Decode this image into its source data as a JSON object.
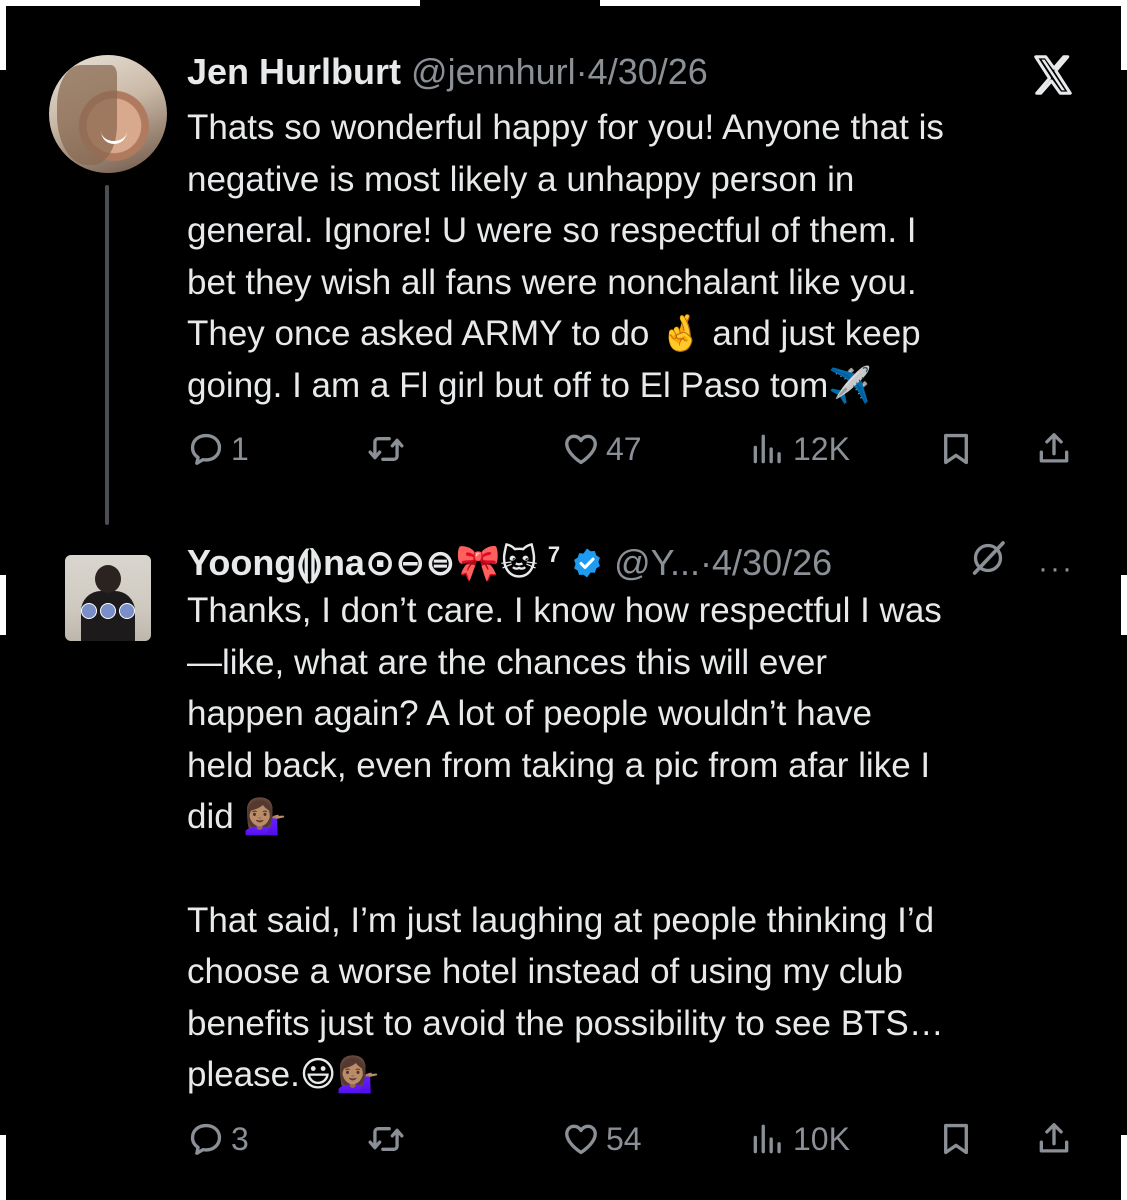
{
  "tweet1": {
    "display_name": "Jen Hurlburt",
    "handle": "@jennhurl",
    "separator": "·",
    "date": "4/30/26",
    "text": "Thats so wonderful happy for you! Anyone that is\nnegative is most likely a unhappy person in\ngeneral. Ignore! U were so respectful of them. I\nbet they wish all fans were nonchalant like you.\nThey once asked ARMY to do 🤞 and just keep\ngoing. I am a Fl girl but off to El Paso tom✈️",
    "replies": "1",
    "reposts": "",
    "likes": "47",
    "views": "12K"
  },
  "tweet2": {
    "display_name": "Yoong⟬⟭na⊙⊖⊜🎀🐱",
    "badge_number": "7",
    "handle": "@Y...",
    "separator": "·",
    "date": "4/30/26",
    "more": "···",
    "text": "Thanks, I don’t care. I know how respectful I was\n—like, what are the chances this will ever\nhappen again? A lot of people wouldn’t have\nheld back, even from taking a pic from afar like I\ndid 💁🏽‍♀️\n\nThat said, I’m just laughing at people thinking I’d\nchoose a worse hotel instead of using my club\nbenefits just to avoid the possibility to see BTS…\nplease.😃💁🏽‍♀️",
    "replies": "3",
    "reposts": "",
    "likes": "54",
    "views": "10K"
  },
  "icons": [
    "x-logo-icon",
    "grok-icon",
    "more-icon",
    "verified-badge-icon",
    "reply-icon",
    "repost-icon",
    "like-icon",
    "views-icon",
    "bookmark-icon",
    "share-icon"
  ],
  "colors": {
    "background": "#000000",
    "text": "#e7e9ea",
    "muted": "#8b9096",
    "verified": "#1d9bf0",
    "thread_line": "#4a4d51"
  }
}
